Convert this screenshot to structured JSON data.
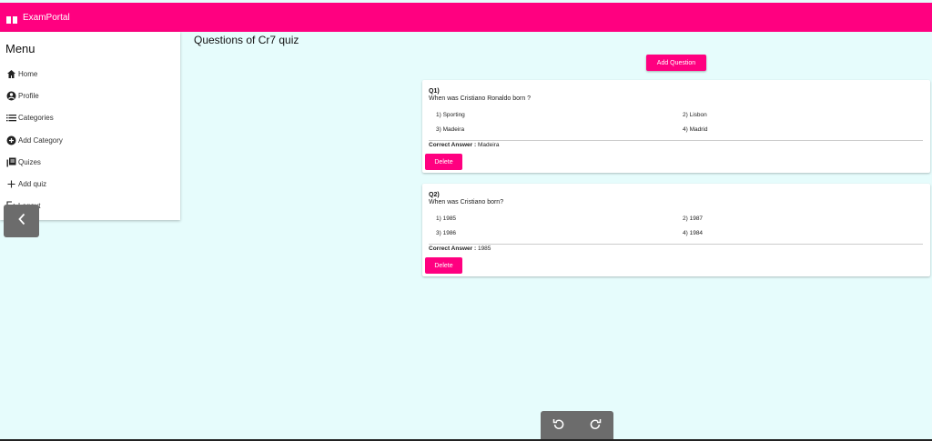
{
  "app": {
    "brand": "ExamPortal"
  },
  "sidebar": {
    "title": "Menu",
    "items": [
      {
        "label": "Home",
        "icon": "home-icon"
      },
      {
        "label": "Profile",
        "icon": "account-icon"
      },
      {
        "label": "Categories",
        "icon": "list-icon"
      },
      {
        "label": "Add Category",
        "icon": "add-circle-icon"
      },
      {
        "label": "Quizes",
        "icon": "library-books-icon"
      },
      {
        "label": "Add quiz",
        "icon": "plus-icon"
      },
      {
        "label": "Logout",
        "icon": "logout-icon"
      }
    ]
  },
  "page": {
    "title": "Questions of Cr7 quiz",
    "add_label": "Add Question"
  },
  "questions": [
    {
      "num": "Q1)",
      "text": "When was Cristiano Ronaldo born ?",
      "options": [
        "1) Sporting",
        "2) Lisbon",
        "3) Madeira",
        "4) Madrid"
      ],
      "answer_label": "Correct Answer :",
      "answer": "Madeira",
      "delete_label": "Delete"
    },
    {
      "num": "Q2)",
      "text": "When was Cristiano born?",
      "options": [
        "1) 1985",
        "2) 1987",
        "3) 1986",
        "4) 1984"
      ],
      "answer_label": "Correct Answer :",
      "answer": "1985",
      "delete_label": "Delete"
    }
  ],
  "colors": {
    "brand": "#ff0080",
    "background": "#e6fcfc",
    "control": "#6c6c6c"
  }
}
